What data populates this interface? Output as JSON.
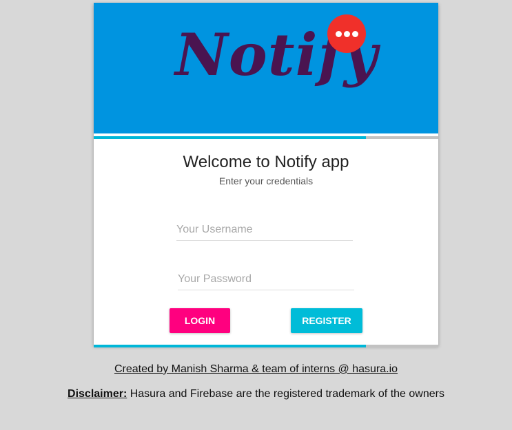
{
  "banner": {
    "logo_text": "Notify",
    "badge_icon": "chat-bubble-dots-icon",
    "background_color": "#0094e0",
    "logo_color": "#4a1450",
    "badge_color": "#f0302a"
  },
  "progress": {
    "top_fraction": 0.79,
    "bottom_fraction": 0.79,
    "fill_color": "#00b7d8",
    "track_color": "#c2c2c2"
  },
  "login": {
    "title": "Welcome to Notify app",
    "subtitle": "Enter your credentials",
    "username_placeholder": "Your Username",
    "username_value": "",
    "password_placeholder": "Your Password",
    "password_value": "",
    "login_label": "LOGIN",
    "register_label": "REGISTER",
    "login_color": "#ff007f",
    "register_color": "#00bcd8"
  },
  "footer": {
    "credits": "Created by Manish Sharma & team of interns @ hasura.io",
    "disclaimer_label": "Disclaimer:",
    "disclaimer_text": " Hasura and Firebase are the registered trademark of the owners"
  }
}
